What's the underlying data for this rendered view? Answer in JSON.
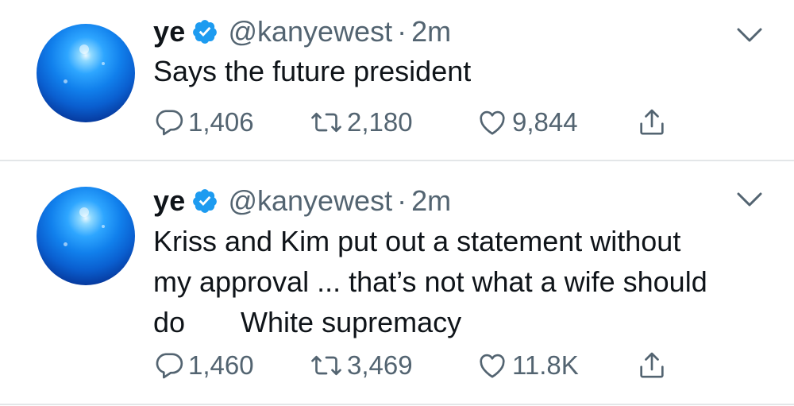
{
  "tweets": [
    {
      "name": "ye",
      "handle": "@kanyewest",
      "separator": "·",
      "time": "2m",
      "text": "Says the future president",
      "replies": "1,406",
      "retweets": "2,180",
      "likes": "9,844"
    },
    {
      "name": "ye",
      "handle": "@kanyewest",
      "separator": "·",
      "time": "2m",
      "text": "Kriss and Kim put out a statement without\nmy approval ... that’s not what a wife should\ndo       White supremacy",
      "replies": "1,460",
      "retweets": "3,469",
      "likes": "11.8K"
    }
  ],
  "colors": {
    "text": "#0f1419",
    "secondary": "#536471",
    "verified": "#1d9bf0",
    "divider": "#e3e6e8"
  },
  "icons": [
    "verified-badge-icon",
    "chevron-down-icon",
    "reply-icon",
    "retweet-icon",
    "like-icon",
    "share-icon"
  ]
}
